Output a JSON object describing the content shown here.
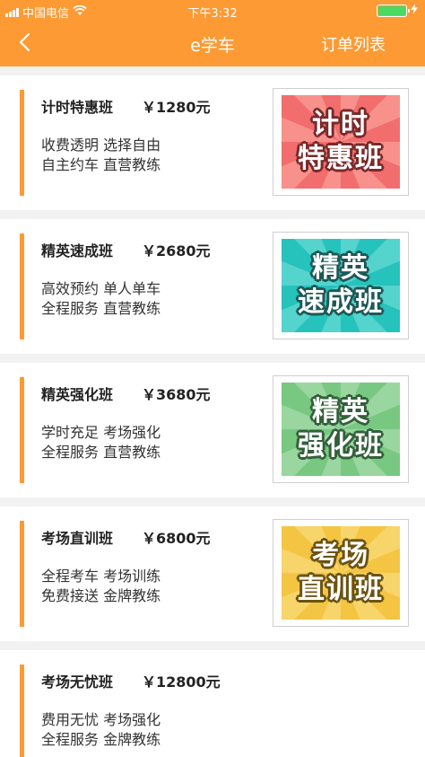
{
  "status_bar": {
    "carrier": "中国电信",
    "time": "下午3:32"
  },
  "nav": {
    "title": "e学车",
    "order_list": "订单列表"
  },
  "colors": {
    "header": "#fd9a34",
    "accent_bar": "#fd9a34",
    "battery": "#4cd964"
  },
  "courses": [
    {
      "name": "计时特惠班",
      "price": "￥1280元",
      "desc_line1": "收费透明   选择自由",
      "desc_line2": "自主约车   直营教练",
      "art_line1": "计时",
      "art_line2": "特惠班",
      "art_color": "#f26d6d",
      "art_ray": "#f8918c",
      "art_stroke": "#7a2a2a"
    },
    {
      "name": "精英速成班",
      "price": "￥2680元",
      "desc_line1": "高效预约  单人单车",
      "desc_line2": "全程服务  直营教练",
      "art_line1": "精英",
      "art_line2": "速成班",
      "art_color": "#26c3bd",
      "art_ray": "#55d3cd",
      "art_stroke": "#1d5956"
    },
    {
      "name": "精英强化班",
      "price": "￥3680元",
      "desc_line1": "学时充足  考场强化",
      "desc_line2": "全程服务  直营教练",
      "art_line1": "精英",
      "art_line2": "强化班",
      "art_color": "#79c882",
      "art_ray": "#9ad6a0",
      "art_stroke": "#33603a"
    },
    {
      "name": "考场直训班",
      "price": "￥6800元",
      "desc_line1": "全程考车  考场训练",
      "desc_line2": "免费接送  金牌教练",
      "art_line1": "考场",
      "art_line2": "直训班",
      "art_color": "#f4c542",
      "art_ray": "#f8d56a",
      "art_stroke": "#6b5312"
    },
    {
      "name": "考场无忧班",
      "price": "￥12800元",
      "desc_line1": "费用无忧  考场强化",
      "desc_line2": "全程服务  金牌教练"
    }
  ]
}
